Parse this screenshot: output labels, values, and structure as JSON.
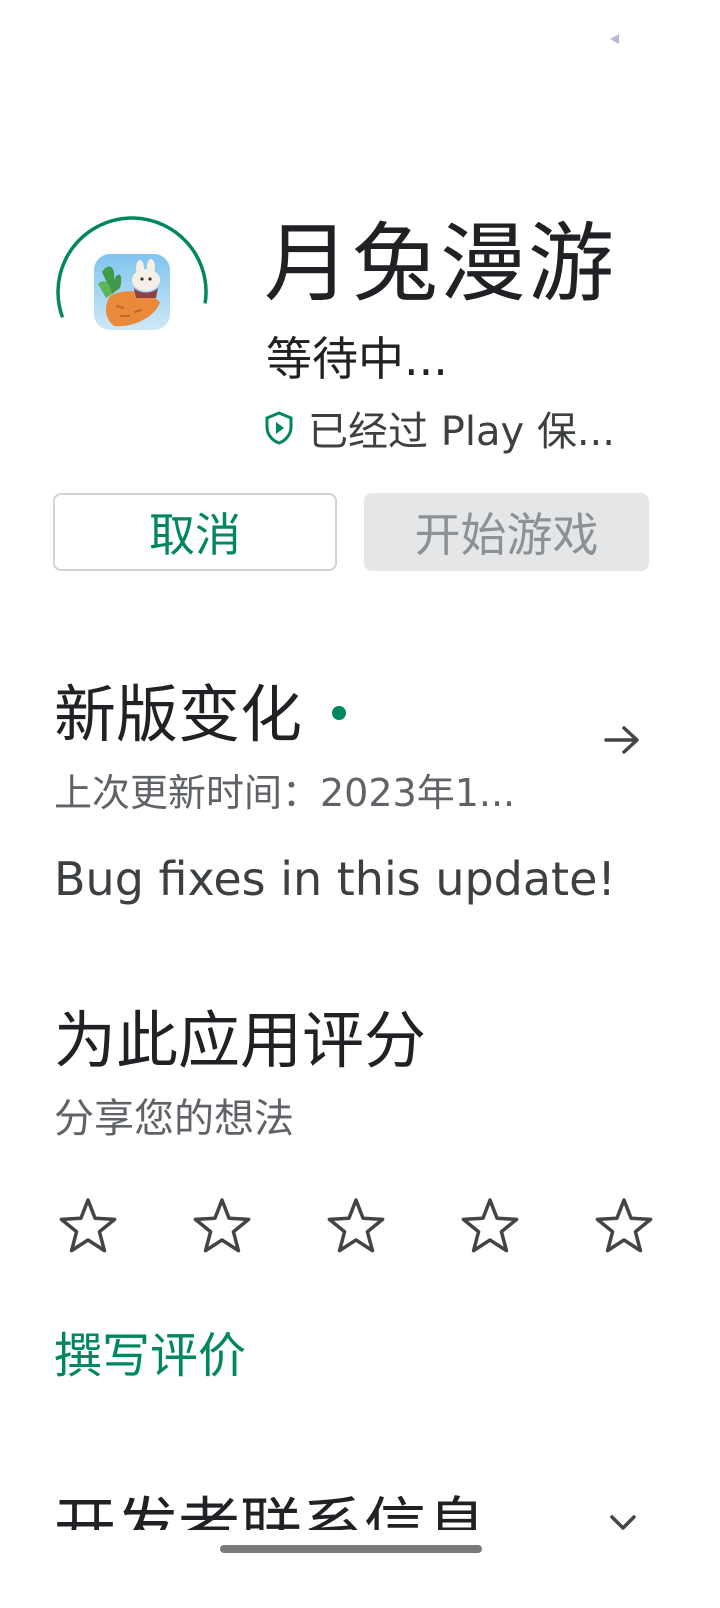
{
  "app": {
    "title": "月兔漫游",
    "status": "等待中...",
    "play_protect": "已经过 Play 保...",
    "download_progress": 0.58
  },
  "actions": {
    "cancel_label": "取消",
    "start_label": "开始游戏"
  },
  "whats_new": {
    "title": "新版变化",
    "updated": "上次更新时间：2023年1...",
    "notes": "Bug fixes in this update!"
  },
  "rate": {
    "title": "为此应用评分",
    "subtitle": "分享您的想法",
    "stars": 5,
    "write_review": "撰写评价"
  },
  "developer": {
    "title": "开发者联系信息"
  },
  "colors": {
    "accent": "#01875f",
    "text": "#202124",
    "muted": "#5f6368"
  }
}
